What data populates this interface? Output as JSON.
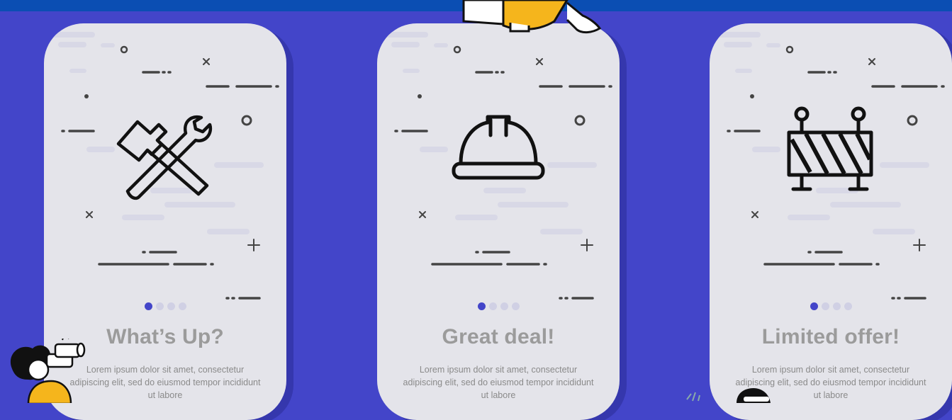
{
  "screens": [
    {
      "title": "What’s Up?",
      "body": "Lorem ipsum dolor sit amet, consectetur adipiscing elit, sed do eiusmod tempor incididunt ut labore",
      "icon": "hammer-wrench-icon",
      "active_dot": 1
    },
    {
      "title": "Great deal!",
      "body": "Lorem ipsum dolor sit amet, consectetur adipiscing elit, sed do eiusmod tempor incididunt ut labore",
      "icon": "hard-hat-icon",
      "active_dot": 1
    },
    {
      "title": "Limited offer!",
      "body": "Lorem ipsum dolor sit amet, consectetur adipiscing elit, sed do eiusmod tempor incididunt ut labore",
      "icon": "road-barrier-icon",
      "active_dot": 1
    }
  ],
  "colors": {
    "background": "#4345c9",
    "top_bar": "#0b4eb3",
    "card": "#e4e4ea",
    "accent_dot": "#4345c9",
    "title_text": "#9b9b9b",
    "character_yellow": "#f5b51c"
  }
}
